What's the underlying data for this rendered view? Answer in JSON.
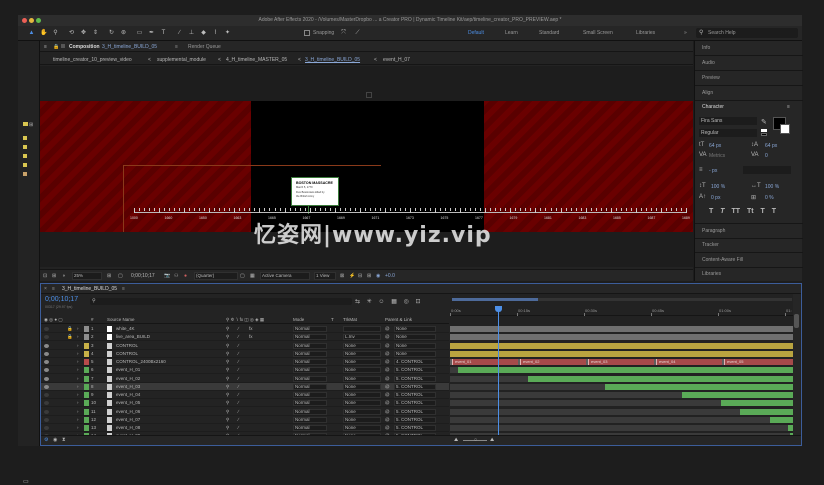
{
  "app": {
    "title": "Adobe After Effects 2020 - /Volumes/MasterDropbo ... a Creator PRO | Dynamic Timeline Kit/aep/timeline_creator_PRO_PREVIEW.aep *"
  },
  "toolbar": {
    "snapping_label": "Snapping",
    "workspaces": [
      "Default",
      "Learn",
      "Standard",
      "Small Screen",
      "Libraries"
    ],
    "search_placeholder": "Search Help"
  },
  "composition_panel": {
    "tab_prefix": "Composition",
    "tab_name": "3_H_timeline_BUILD_05",
    "render_queue_tab": "Render Queue",
    "breadcrumbs": [
      "timeline_creator_10_preview_video",
      "supplemental_module",
      "4_H_timeline_MASTER_05",
      "3_H_timeline_BUILD_05",
      "event_H_07"
    ],
    "event_card": {
      "title": "BOSTON MASSACRE",
      "date": "March 5, 1770",
      "line1": "Five Bostonians killed by",
      "line2": "the British Army"
    },
    "ruler_labels": [
      "1000",
      "1660",
      "1650",
      "1663",
      "1665",
      "1667",
      "1669",
      "1671",
      "1673",
      "1675",
      "1677",
      "1679",
      "1681",
      "1683",
      "1685",
      "1687",
      "1689"
    ],
    "footer": {
      "zoom": "25%",
      "timecode": "0;00;10;17",
      "resolution": "(Quarter)",
      "camera": "Active Camera",
      "views": "1 View",
      "exposure": "+0.0"
    }
  },
  "right_panel": {
    "top_items": [
      "Info",
      "Audio",
      "Preview",
      "Align"
    ],
    "character_label": "Character",
    "font": "Fira Sans",
    "style": "Regular",
    "font_size": "64 px",
    "leading": "64 px",
    "kerning": "Metrics",
    "tracking": "0",
    "stroke": "- px",
    "vscale": "100 %",
    "hscale": "100 %",
    "baseline": "0 px",
    "tsume": "0 %",
    "style_buttons": [
      "T",
      "T",
      "TT",
      "Tt",
      "T",
      "T"
    ],
    "bottom_items": [
      "Paragraph",
      "Tracker",
      "Content-Aware Fill",
      "Libraries"
    ]
  },
  "timeline": {
    "tab": "3_H_timeline_BUILD_05",
    "timecode": "0;00;10;17",
    "fps": "00317 (29.97 fps)",
    "search_placeholder": "",
    "columns": {
      "num": "#",
      "source_name": "Source Name",
      "mode": "Mode",
      "t": "T",
      "trkmat": "TrkMat",
      "parent": "Parent & Link"
    },
    "ruler": [
      "0:00s",
      "00:15s",
      "00:30s",
      "00:45s",
      "01:00s",
      "01:"
    ],
    "layers": [
      {
        "num": "1",
        "name": "white_4K",
        "color": "#8e8e8e",
        "mode": "Normal",
        "trkmat": "",
        "parent": "None"
      },
      {
        "num": "2",
        "name": "live_area_BUILD",
        "color": "#8e8e8e",
        "mode": "Normal",
        "trkmat": "L.Inv",
        "parent": "None"
      },
      {
        "num": "3",
        "name": "CONTROL",
        "color": "#c9b248",
        "mode": "Normal",
        "trkmat": "None",
        "parent": "None"
      },
      {
        "num": "4",
        "name": "CONTROL",
        "color": "#c9b248",
        "mode": "Normal",
        "trkmat": "None",
        "parent": "None"
      },
      {
        "num": "5",
        "name": "CONTROL_2400Bx2160",
        "color": "#b84a4a",
        "mode": "Normal",
        "trkmat": "None",
        "parent": "4. CONTROL"
      },
      {
        "num": "6",
        "name": "event_H_01",
        "color": "#5aaa57",
        "mode": "Normal",
        "trkmat": "None",
        "parent": "5. CONTROL"
      },
      {
        "num": "7",
        "name": "event_H_02",
        "color": "#5aaa57",
        "mode": "Normal",
        "trkmat": "None",
        "parent": "5. CONTROL"
      },
      {
        "num": "8",
        "name": "event_H_03",
        "color": "#5aaa57",
        "mode": "Normal",
        "trkmat": "None",
        "parent": "5. CONTROL"
      },
      {
        "num": "9",
        "name": "event_H_04",
        "color": "#5aaa57",
        "mode": "Normal",
        "trkmat": "None",
        "parent": "5. CONTROL"
      },
      {
        "num": "10",
        "name": "event_H_05",
        "color": "#5aaa57",
        "mode": "Normal",
        "trkmat": "None",
        "parent": "5. CONTROL"
      },
      {
        "num": "11",
        "name": "event_H_06",
        "color": "#5aaa57",
        "mode": "Normal",
        "trkmat": "None",
        "parent": "5. CONTROL"
      },
      {
        "num": "12",
        "name": "event_H_07",
        "color": "#5aaa57",
        "mode": "Normal",
        "trkmat": "None",
        "parent": "5. CONTROL"
      },
      {
        "num": "13",
        "name": "event_H_08",
        "color": "#5aaa57",
        "mode": "Normal",
        "trkmat": "None",
        "parent": "5. CONTROL"
      },
      {
        "num": "14",
        "name": "event_H_09",
        "color": "#5aaa57",
        "mode": "Normal",
        "trkmat": "None",
        "parent": "5. CONTROL"
      }
    ],
    "markers": [
      "event_01",
      "event_02",
      "event_03",
      "event_04",
      "event_05"
    ]
  },
  "watermark": "忆姿网|www.yiz.vip",
  "colors": {
    "accent": "#4d8fe6",
    "marker": "#a64a4a",
    "track_green": "#5aaa57",
    "track_yellow": "#b9a440",
    "canvas_red": "#6a0000"
  }
}
